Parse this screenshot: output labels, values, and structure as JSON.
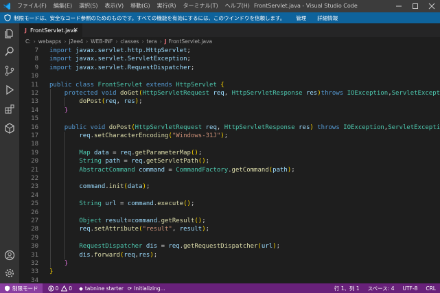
{
  "titlebar": {
    "menus": [
      "ファイル(F)",
      "編集(E)",
      "選択(S)",
      "表示(V)",
      "移動(G)",
      "実行(R)",
      "ターミナル(T)",
      "ヘルプ(H)"
    ],
    "window_title": "FrontServlet.java - Visual Studio Code"
  },
  "banner": {
    "text": "制限モードは、安全なコード参照のためのものです。すべての機能を有効にするには、このウインドウを信頼します。",
    "manage_link": "管理",
    "details_link": "詳細情報"
  },
  "tab": {
    "label": "FrontServlet.java",
    "close": "×"
  },
  "breadcrumb": [
    "C:",
    "webapps",
    "j2ee4",
    "WEB-INF",
    "classes",
    "tera",
    "FrontServlet.java"
  ],
  "code_lines": [
    {
      "n": "7",
      "t": "import javax.servlet.http.HttpServlet;"
    },
    {
      "n": "8",
      "t": "import javax.servlet.ServletException;"
    },
    {
      "n": "9",
      "t": "import javax.servlet.RequestDispatcher;"
    },
    {
      "n": "10",
      "t": ""
    },
    {
      "n": "11",
      "t": "public class FrontServlet extends HttpServlet {"
    },
    {
      "n": "12",
      "t": "    protected void doGet(HttpServletRequest req, HttpServletResponse res)throws IOException,ServletException{"
    },
    {
      "n": "13",
      "t": "        doPost(req, res);"
    },
    {
      "n": "14",
      "t": "    }"
    },
    {
      "n": "15",
      "t": ""
    },
    {
      "n": "16",
      "t": "    public void doPost(HttpServletRequest req, HttpServletResponse res) throws IOException,ServletException{"
    },
    {
      "n": "17",
      "t": "        req.setCharacterEncoding(\"Windows-31J\");"
    },
    {
      "n": "18",
      "t": ""
    },
    {
      "n": "19",
      "t": "        Map data = req.getParameterMap();"
    },
    {
      "n": "20",
      "t": "        String path = req.getServletPath();"
    },
    {
      "n": "21",
      "t": "        AbstractCommand command = CommandFactory.getCommand(path);"
    },
    {
      "n": "22",
      "t": ""
    },
    {
      "n": "23",
      "t": "        command.init(data);"
    },
    {
      "n": "24",
      "t": ""
    },
    {
      "n": "25",
      "t": "        String url = command.execute();"
    },
    {
      "n": "26",
      "t": ""
    },
    {
      "n": "27",
      "t": "        Object result=command.getResult();"
    },
    {
      "n": "28",
      "t": "        req.setAttribute(\"result\", result);"
    },
    {
      "n": "29",
      "t": ""
    },
    {
      "n": "30",
      "t": "        RequestDispatcher dis = req.getRequestDispatcher(url);"
    },
    {
      "n": "31",
      "t": "        dis.forward(req,res);"
    },
    {
      "n": "32",
      "t": "    }"
    },
    {
      "n": "33",
      "t": "}"
    },
    {
      "n": "34",
      "t": ""
    }
  ],
  "statusbar": {
    "mode": "制限モード",
    "errors": "0",
    "warnings": "0",
    "tabnine": "tabnine starter",
    "initializing": "Initializing...",
    "position": "行 1、列 1",
    "spaces": "スペース: 4",
    "encoding": "UTF-8",
    "eol": "CRL"
  },
  "colors": {
    "titlebar": "#3c3c3c",
    "banner": "#0e639c",
    "activity_bar": "#333333",
    "editor_bg": "#1e1e1e",
    "statusbar": "#68217a",
    "keyword": "#569cd6",
    "type": "#4ec9b0",
    "function": "#dcdcaa",
    "string": "#ce9178"
  },
  "icons": {
    "activity": [
      "files-icon",
      "search-icon",
      "source-control-icon",
      "run-debug-icon",
      "extensions-icon",
      "remote-explorer-icon",
      "account-icon",
      "settings-gear-icon"
    ]
  }
}
